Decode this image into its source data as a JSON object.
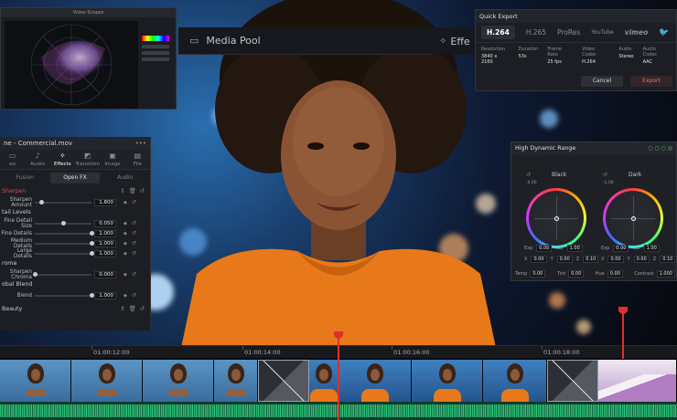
{
  "toolbar": {
    "media_pool_label": "Media Pool",
    "effects_label": "Effe"
  },
  "scope": {
    "title": "Video Scopes"
  },
  "inspector": {
    "title": "ne - Commercial.mov",
    "tabs": [
      {
        "icon": "video-icon",
        "label": "eo"
      },
      {
        "icon": "audio-icon",
        "label": "Audio"
      },
      {
        "icon": "effects-icon",
        "label": "Effects"
      },
      {
        "icon": "transition-icon",
        "label": "Transition"
      },
      {
        "icon": "image-icon",
        "label": "Image"
      },
      {
        "icon": "file-icon",
        "label": "File"
      }
    ],
    "sub_tabs": [
      "Fusion",
      "Open FX",
      "Audio"
    ],
    "sections": {
      "sharpen": "Sharpen",
      "detail_levels": "tail Levels",
      "chroma": "roma",
      "global_blend": "obal Blend",
      "beauty": "Beauty"
    },
    "params": {
      "sharpen_amount": {
        "label": "Sharpen Amount",
        "value": "1.800",
        "knob": 0.12
      },
      "fine_detail_size": {
        "label": "Fine Detail Size",
        "value": "0.050",
        "knob": 0.5
      },
      "fine_details": {
        "label": "Fine Details",
        "value": "1.000",
        "knob": 1.0
      },
      "medium_details": {
        "label": "Medium Details",
        "value": "1.000",
        "knob": 1.0
      },
      "large_details": {
        "label": "Large Details",
        "value": "1.000",
        "knob": 1.0
      },
      "sharpen_chroma": {
        "label": "Sharpen Chroma",
        "value": "0.000",
        "knob": 0.0
      },
      "blend": {
        "label": "Blend",
        "value": "1.000",
        "knob": 1.0
      }
    }
  },
  "quick_export": {
    "title": "Quick Export",
    "formats": [
      "H.264",
      "H.265",
      "ProRes",
      "YouTube",
      "vimeo",
      "twitter-icon"
    ],
    "info": [
      {
        "label": "Resolution",
        "value": "3840 x 2160"
      },
      {
        "label": "Duration",
        "value": "53s"
      },
      {
        "label": "Frame Rate",
        "value": "25 fps"
      },
      {
        "label": "Video Codec",
        "value": "H.264"
      },
      {
        "label": "Audio",
        "value": "Stereo"
      },
      {
        "label": "Audio Codec",
        "value": "AAC"
      }
    ],
    "cancel_label": "Cancel",
    "export_label": "Export"
  },
  "hdr": {
    "title": "High Dynamic Range",
    "wheels": [
      {
        "name": "Black",
        "ev": "-4.00",
        "exp": "0.00",
        "sat": "1.00",
        "x": "0.00",
        "y": "0.00",
        "z": "0.10"
      },
      {
        "name": "Dark",
        "ev": "-1.50",
        "exp": "0.00",
        "sat": "1.00",
        "x": "0.00",
        "y": "0.00",
        "z": "0.10"
      }
    ],
    "labels": {
      "exp": "Exp",
      "sat": "Sat",
      "x": "X",
      "y": "Y",
      "z": "Z"
    },
    "footer": [
      {
        "label": "Temp",
        "value": "0.00"
      },
      {
        "label": "Tint",
        "value": "0.00"
      },
      {
        "label": "Hue",
        "value": "0.00"
      },
      {
        "label": "Contrast",
        "value": "1.000"
      }
    ]
  },
  "timeline": {
    "timecodes": [
      "01:00:12:00",
      "01:00:14:00",
      "01:00:16:00",
      "01:00:18:00"
    ]
  },
  "colors": {
    "accent": "#e0302b",
    "export_accent": "#ff6a4d",
    "audio_wave": "#2bd17d"
  }
}
